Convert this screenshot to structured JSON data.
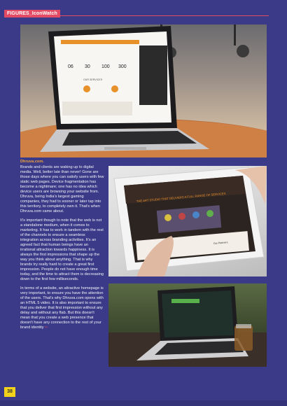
{
  "section_tag": "FIGURES_IconWatch",
  "article": {
    "lead": "Dhruva.com.",
    "p1": "Brands and clients are waking up to digital media. Well, better late than never! Gone are those days where you can satisfy users with few static web pages. Device fragmentation has become a nightmare; one has no idea which device users are browsing your website from. Dhruva, being India's largest gaming companies, they had to sooner or later tap into this territory, to completely own it. That's when Dhruva.com came about.",
    "p2": "It's important though to note that the web is not a standalone medium, when it comes to marketing. It has to work in tandem with the rest of the channels to ensure a seamless integration across branding activities. It's an agreed fact that human beings have an irrational attraction towards happiness. It is always the first impressions that shape up the way you think about anything. That is why brands try really hard to create a great first impression. People do not have enough time today, and the time to attract them is decreasing down to the first few milliseconds.",
    "p3": "In terms of a website, an attractive homepage is very important, to ensure you have the attention of the users. That's why Dhruva.com opens with an HTML 5 video. It is also important to ensure that you deliver that first impression without any delay and without any flab. But this doesn't mean that you create a web presence that doesn't have any connection to the rest of your brand identity",
    "end_mark": "<-"
  },
  "laptop_screen": {
    "stats": [
      "06",
      "30",
      "100",
      "300"
    ],
    "heading": "OUR SERVICES"
  },
  "tablet_screen": {
    "banner": "THE ART STUDIO THAT DELIVERS A FULL RANGE OF SERVICES",
    "caption": "Our Partners"
  },
  "page_number": "38",
  "colors": {
    "page_bg": "#3b3a88",
    "accent": "#e24b63",
    "lead": "#f0a23a",
    "page_num_bg": "#f2d21a"
  }
}
